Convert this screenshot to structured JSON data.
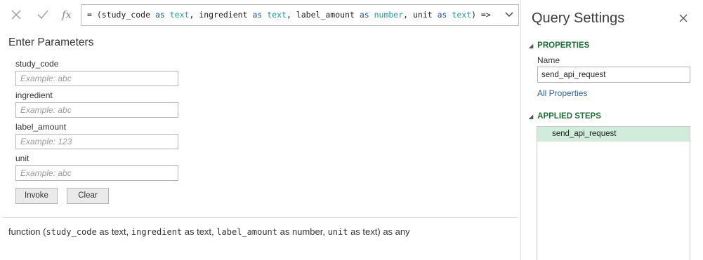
{
  "formula_bar": {
    "tools": [
      "cancel-icon",
      "check-icon",
      "function-icon"
    ],
    "fx_label": "fx",
    "formula": [
      {
        "t": "= (study_code ",
        "c": "plain"
      },
      {
        "t": "as",
        "c": "kw"
      },
      {
        "t": " ",
        "c": "plain"
      },
      {
        "t": "text",
        "c": "ty"
      },
      {
        "t": ", ingredient ",
        "c": "plain"
      },
      {
        "t": "as",
        "c": "kw"
      },
      {
        "t": " ",
        "c": "plain"
      },
      {
        "t": "text",
        "c": "ty"
      },
      {
        "t": ", label_amount ",
        "c": "plain"
      },
      {
        "t": "as",
        "c": "kw"
      },
      {
        "t": " ",
        "c": "plain"
      },
      {
        "t": "number",
        "c": "ty"
      },
      {
        "t": ", unit ",
        "c": "plain"
      },
      {
        "t": "as",
        "c": "kw"
      },
      {
        "t": " ",
        "c": "plain"
      },
      {
        "t": "text",
        "c": "ty"
      },
      {
        "t": ") =>",
        "c": "plain"
      }
    ],
    "expand_icon": "chevron-down-icon"
  },
  "parameters": {
    "title": "Enter Parameters",
    "fields": [
      {
        "label": "study_code",
        "value": "",
        "placeholder": "Example: abc"
      },
      {
        "label": "ingredient",
        "value": "",
        "placeholder": "Example: abc"
      },
      {
        "label": "label_amount",
        "value": "",
        "placeholder": "Example: 123"
      },
      {
        "label": "unit",
        "value": "",
        "placeholder": "Example: abc"
      }
    ],
    "invoke_label": "Invoke",
    "clear_label": "Clear"
  },
  "signature": {
    "prefix": "function (",
    "params": [
      {
        "name": "study_code",
        "type": " as text"
      },
      {
        "name": "ingredient",
        "type": " as text"
      },
      {
        "name": "label_amount",
        "type": " as number"
      },
      {
        "name": "unit",
        "type": " as text"
      }
    ],
    "separator": ", ",
    "suffix": ") as any"
  },
  "query_settings": {
    "title": "Query Settings",
    "close_icon": "close-icon",
    "properties_heading": "PROPERTIES",
    "name_label": "Name",
    "name_value": "send_api_request",
    "all_properties_label": "All Properties",
    "applied_steps_heading": "APPLIED STEPS",
    "steps": [
      "send_api_request"
    ]
  },
  "colors": {
    "section_heading": "#1f6b35",
    "selected_step": "#d2ecdc",
    "link": "#2a5ea8",
    "keyword": "#1f4fa8",
    "type": "#1f9a9a"
  }
}
